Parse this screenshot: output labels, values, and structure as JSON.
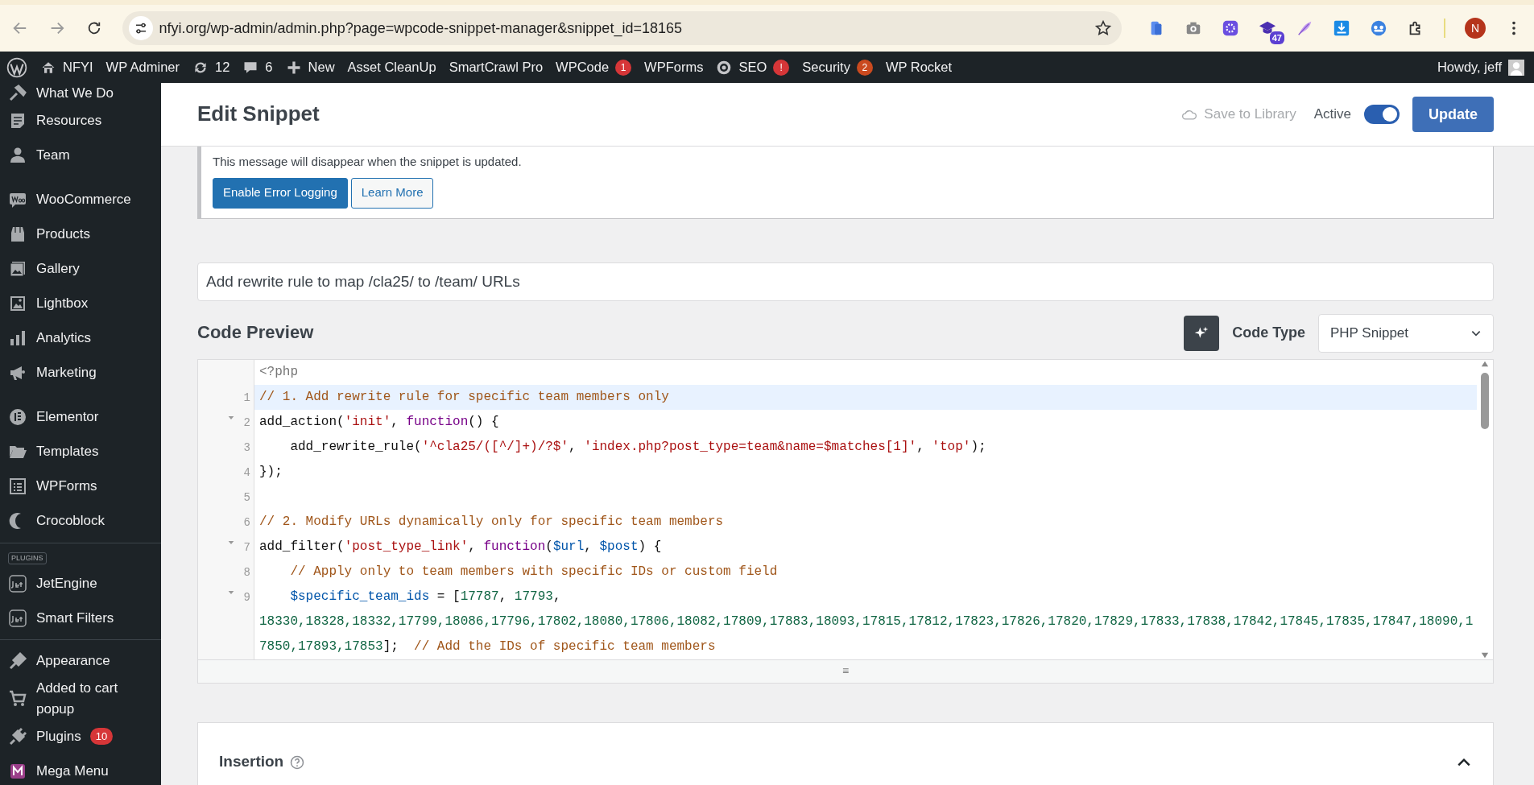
{
  "browser": {
    "url": "nfyi.org/wp-admin/admin.php?page=wpcode-snippet-manager&snippet_id=18165",
    "extension_badge": "47",
    "profile_initial": "N"
  },
  "admin_bar": {
    "items": [
      {
        "label": "NFYI"
      },
      {
        "label": "WP Adminer"
      },
      {
        "label": "12"
      },
      {
        "label": "6"
      },
      {
        "label": "New"
      },
      {
        "label": "Asset CleanUp"
      },
      {
        "label": "SmartCrawl Pro"
      },
      {
        "label": "WPCode",
        "badge": {
          "text": "1",
          "color": "#d63638"
        }
      },
      {
        "label": "WPForms"
      },
      {
        "label": "SEO",
        "badge": {
          "text": "!",
          "color": "#d63638"
        }
      },
      {
        "label": "Security",
        "badge": {
          "text": "2",
          "color": "#ca4a1f"
        }
      },
      {
        "label": "WP Rocket"
      }
    ],
    "greeting": "Howdy, jeff"
  },
  "sidebar": {
    "groups": [
      {
        "items": [
          {
            "label": "What We Do"
          },
          {
            "label": "Resources"
          },
          {
            "label": "Team"
          }
        ]
      },
      {
        "divider": false,
        "items": [
          {
            "label": "WooCommerce"
          },
          {
            "label": "Products"
          },
          {
            "label": "Gallery"
          },
          {
            "label": "Lightbox"
          },
          {
            "label": "Analytics"
          },
          {
            "label": "Marketing"
          }
        ]
      },
      {
        "divider": false,
        "items": [
          {
            "label": "Elementor"
          },
          {
            "label": "Templates"
          },
          {
            "label": "WPForms"
          },
          {
            "label": "Crocoblock"
          }
        ]
      },
      {
        "divider": true,
        "label": "PLUGINS",
        "items": [
          {
            "label": "JetEngine"
          },
          {
            "label": "Smart Filters"
          }
        ]
      },
      {
        "divider": true,
        "items": [
          {
            "label": "Appearance"
          },
          {
            "label": "Added to cart popup"
          },
          {
            "label": "Plugins",
            "badge": "10"
          },
          {
            "label": "Mega Menu"
          }
        ]
      }
    ]
  },
  "header": {
    "title": "Edit Snippet",
    "save_to_library": {
      "label": "Save to Library",
      "disabled": true
    },
    "active": {
      "label": "Active",
      "on": true
    },
    "update_button": "Update"
  },
  "notice": {
    "message": "This message will disappear when the snippet is updated.",
    "buttons": [
      {
        "label": "Enable Error Logging",
        "primary": true
      },
      {
        "label": "Learn More",
        "primary": false
      }
    ]
  },
  "snippet_title": {
    "value": "Add rewrite rule to map /cla25/ to /team/ URLs"
  },
  "code_preview": {
    "heading": "Code Preview",
    "code_type_label": "Code Type",
    "code_type": "PHP Snippet",
    "resize_handle": "≡",
    "lines": [
      {
        "fold": false,
        "highlighted": false,
        "tokens": [
          {
            "kind": "tag",
            "text": "<?php"
          }
        ]
      },
      {
        "number": "1",
        "fold": false,
        "highlighted": true,
        "tokens": [
          {
            "kind": "comment",
            "text": "// 1. Add rewrite rule for specific team members only"
          }
        ]
      },
      {
        "number": "2",
        "fold": true,
        "highlighted": false,
        "tokens": [
          {
            "kind": "plain",
            "text": "add_action("
          },
          {
            "kind": "string",
            "text": "'init'"
          },
          {
            "kind": "plain",
            "text": ", "
          },
          {
            "kind": "keyword",
            "text": "function"
          },
          {
            "kind": "plain",
            "text": "() {"
          }
        ]
      },
      {
        "number": "3",
        "fold": false,
        "highlighted": false,
        "tokens": [
          {
            "kind": "plain",
            "text": "    add_rewrite_rule("
          },
          {
            "kind": "string",
            "text": "'^cla25/([^/]+)/?$'"
          },
          {
            "kind": "plain",
            "text": ", "
          },
          {
            "kind": "string",
            "text": "'index.php?post_type=team&name=$matches[1]'"
          },
          {
            "kind": "plain",
            "text": ", "
          },
          {
            "kind": "string",
            "text": "'top'"
          },
          {
            "kind": "plain",
            "text": ");"
          }
        ]
      },
      {
        "number": "4",
        "fold": false,
        "highlighted": false,
        "tokens": [
          {
            "kind": "plain",
            "text": "});"
          }
        ]
      },
      {
        "number": "5",
        "fold": false,
        "highlighted": false
      },
      {
        "number": "6",
        "fold": false,
        "highlighted": false,
        "tokens": [
          {
            "kind": "comment",
            "text": "// 2. Modify URLs dynamically only for specific team members"
          }
        ]
      },
      {
        "number": "7",
        "fold": true,
        "highlighted": false,
        "tokens": [
          {
            "kind": "plain",
            "text": "add_filter("
          },
          {
            "kind": "string",
            "text": "'post_type_link'"
          },
          {
            "kind": "plain",
            "text": ", "
          },
          {
            "kind": "keyword",
            "text": "function"
          },
          {
            "kind": "plain",
            "text": "("
          },
          {
            "kind": "variable",
            "text": "$url"
          },
          {
            "kind": "plain",
            "text": ", "
          },
          {
            "kind": "variable",
            "text": "$post"
          },
          {
            "kind": "plain",
            "text": ") {"
          }
        ]
      },
      {
        "number": "8",
        "fold": false,
        "highlighted": false,
        "tokens": [
          {
            "kind": "comment",
            "text": "    // Apply only to team members with specific IDs or custom field"
          }
        ]
      },
      {
        "number": "9",
        "fold": true,
        "highlighted": false,
        "tokens": [
          {
            "kind": "variable",
            "text": "    $specific_team_ids"
          },
          {
            "kind": "plain",
            "text": " = ["
          },
          {
            "kind": "number",
            "text": "17787"
          },
          {
            "kind": "plain",
            "text": ", "
          },
          {
            "kind": "number",
            "text": "17793"
          },
          {
            "kind": "plain",
            "text": ", "
          },
          {
            "kind": "number",
            "text": "18330,18328,18332,17799,18086,17796,17802,18080,17806,18082,17809,17883,18093,17815,17812,17823,17826,17820,17829,17833,17838,17842,17845,17835,17847,18090,17850,17893,17853"
          },
          {
            "kind": "plain",
            "text": "];  "
          },
          {
            "kind": "comment",
            "text": "// Add the IDs of specific team members"
          }
        ]
      }
    ]
  },
  "insertion": {
    "heading": "Insertion",
    "expanded": true
  }
}
